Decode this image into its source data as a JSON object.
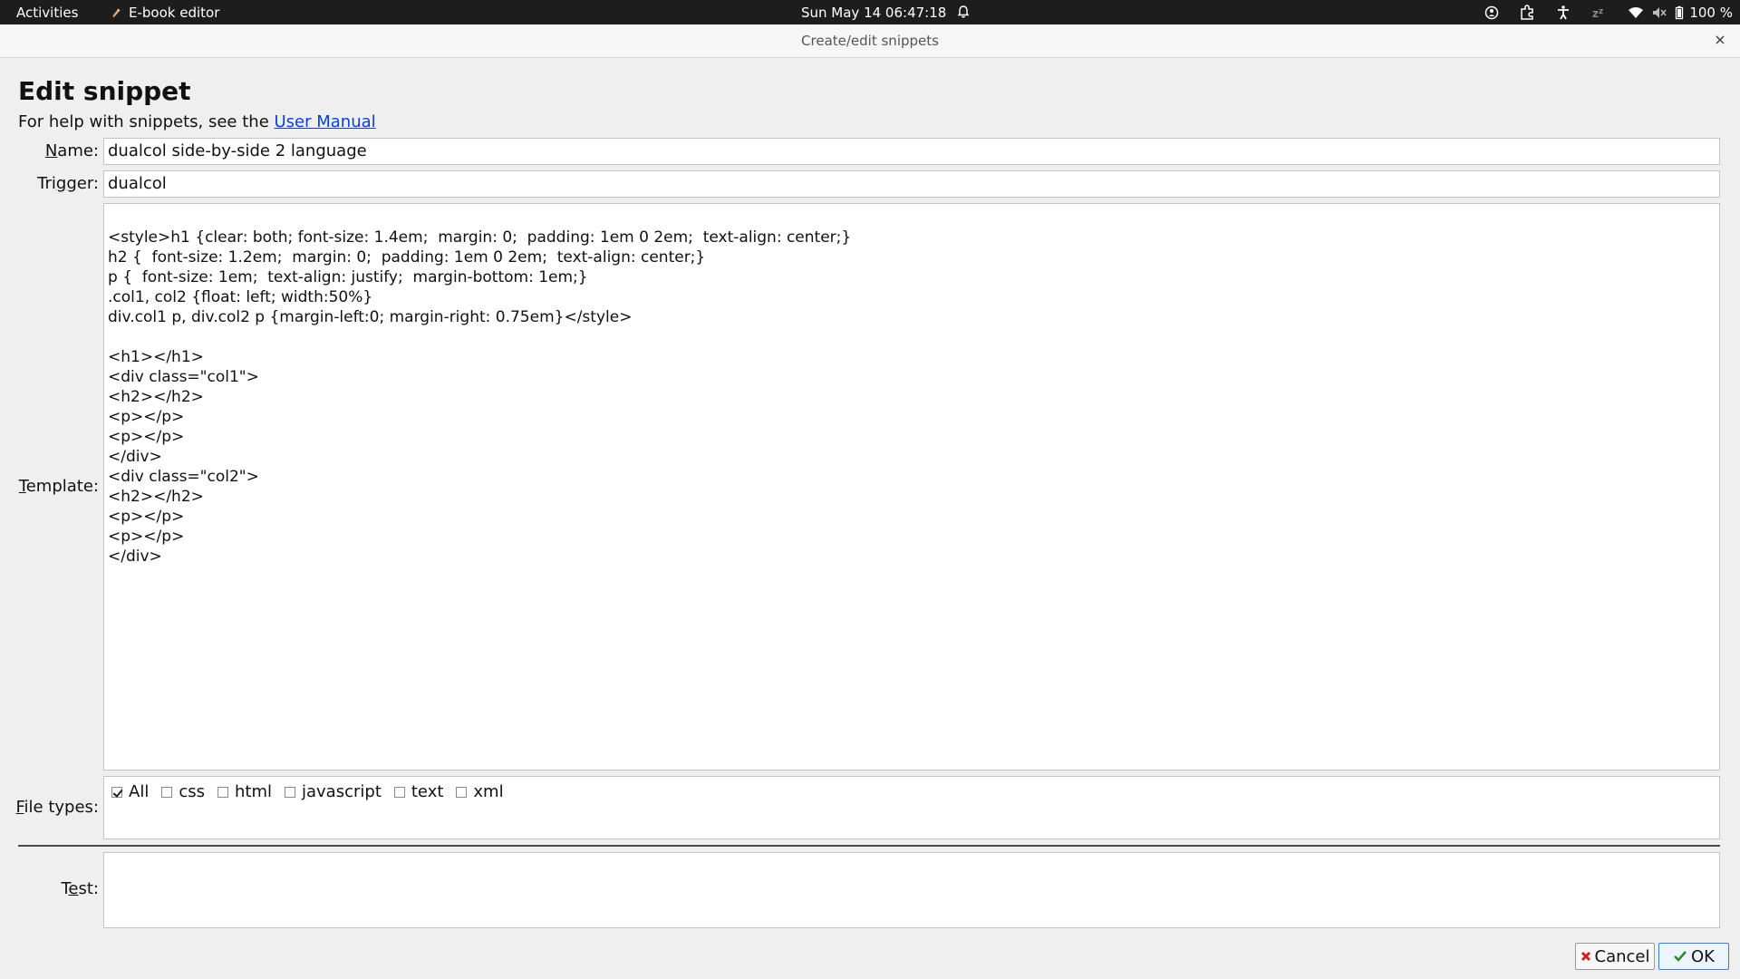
{
  "topbar": {
    "activities": "Activities",
    "app_name": "E-book editor",
    "clock": "Sun May 14  06:47:18",
    "battery": "100 %"
  },
  "dialog": {
    "title": "Create/edit snippets",
    "close": "×",
    "heading": "Edit snippet",
    "help_prefix": "For help with snippets, see the ",
    "help_link": "User Manual"
  },
  "form": {
    "name_label_u": "N",
    "name_label_rest": "ame:",
    "name_value": "dualcol side-by-side 2 language",
    "trigger_label_pre": "Tri",
    "trigger_label_u": "g",
    "trigger_label_rest": "ger:",
    "trigger_value": "dualcol",
    "template_label_u": "T",
    "template_label_rest": "emplate:",
    "template_value": "<style>h1 {clear: both; font-size: 1.4em;  margin: 0;  padding: 1em 0 2em;  text-align: center;}\nh2 {  font-size: 1.2em;  margin: 0;  padding: 1em 0 2em;  text-align: center;}\np {  font-size: 1em;  text-align: justify;  margin-bottom: 1em;}\n.col1, col2 {float: left; width:50%}\ndiv.col1 p, div.col2 p {margin-left:0; margin-right: 0.75em}</style>\n\n<h1></h1>\n<div class=\"col1\">\n<h2></h2>\n<p></p>\n<p></p>\n</div>\n<div class=\"col2\">\n<h2></h2>\n<p></p>\n<p></p>\n</div>",
    "filetypes_label_u": "F",
    "filetypes_label_rest": "ile types:",
    "filetypes": [
      {
        "label": "All",
        "checked": true
      },
      {
        "label": "css",
        "checked": false
      },
      {
        "label": "html",
        "checked": false
      },
      {
        "label": "javascript",
        "checked": false
      },
      {
        "label": "text",
        "checked": false
      },
      {
        "label": "xml",
        "checked": false
      }
    ],
    "test_label_pre": "T",
    "test_label_u": "e",
    "test_label_rest": "st:",
    "test_value": ""
  },
  "buttons": {
    "cancel": "Cancel",
    "ok": "OK"
  },
  "colors": {
    "link": "#0b3fd6",
    "cancel_icon": "#cc1f1f",
    "ok_icon": "#2e8b2e"
  }
}
